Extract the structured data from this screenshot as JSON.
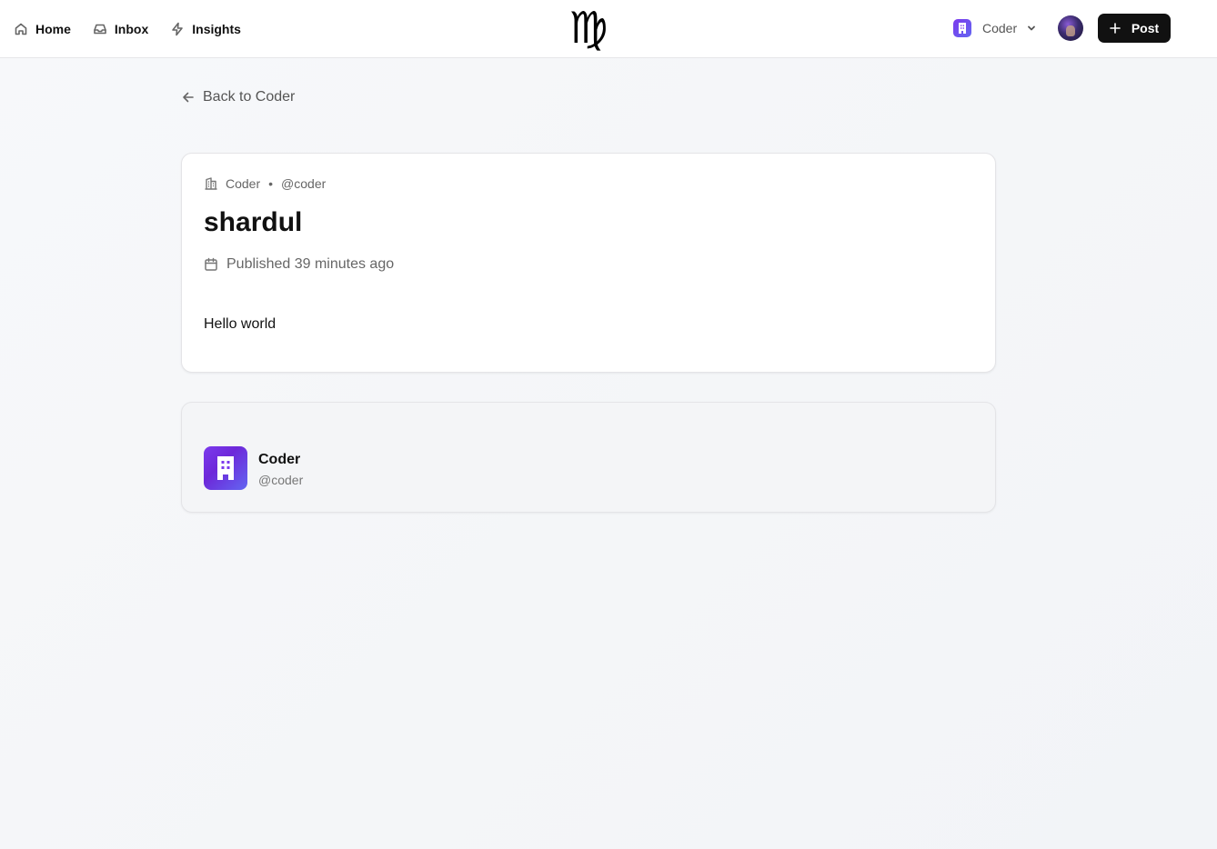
{
  "nav": {
    "items": [
      {
        "label": "Home",
        "icon": "home-icon"
      },
      {
        "label": "Inbox",
        "icon": "inbox-icon"
      },
      {
        "label": "Insights",
        "icon": "lightning-icon"
      }
    ]
  },
  "logo": {
    "glyph": "♍",
    "icon": "virgo-logo-icon"
  },
  "workspace": {
    "name": "Coder",
    "badge_color": "#7c3aed",
    "icon": "building-icon"
  },
  "user": {
    "avatar_icon": "avatar"
  },
  "post_button": {
    "label": "Post",
    "icon": "plus-icon"
  },
  "back_link": {
    "label": "Back to Coder",
    "icon": "arrow-left-icon"
  },
  "post": {
    "org_name": "Coder",
    "separator": "•",
    "org_handle": "@coder",
    "title": "shardul",
    "published": "Published 39 minutes ago",
    "body": "Hello world"
  },
  "author": {
    "name": "Coder",
    "handle": "@coder",
    "logo_color": "#7c3aed"
  }
}
